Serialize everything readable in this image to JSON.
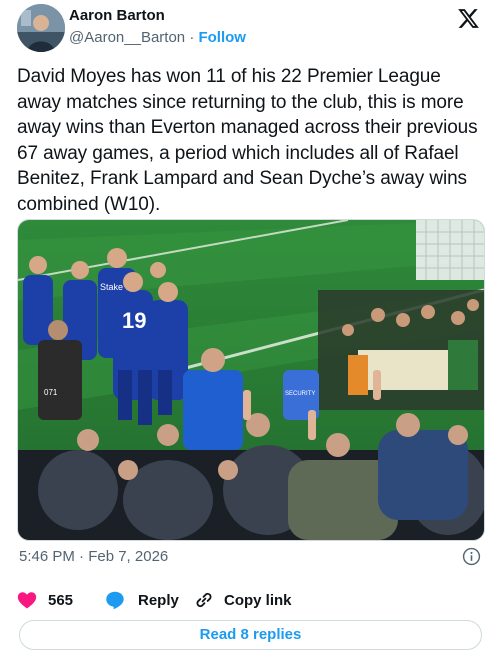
{
  "author": {
    "name": "Aaron Barton",
    "handle": "@Aaron__Barton",
    "separator": "·",
    "follow_label": "Follow"
  },
  "tweet": {
    "text": "David Moyes has won 11 of his 22 Premier League away matches since returning to the club, this is more away wins than Everton managed across their previous 67 away games, a period which includes all of Rafael Benitez, Frank Lampard and Sean Dyche’s away wins combined (W10).",
    "photo": {
      "shirt_number": "19",
      "sponsor": "Stake",
      "camera_bib_number": "071",
      "steward_vest_text": "SECURITY"
    },
    "timestamp": "5:46 PM · Feb 7, 2026"
  },
  "actions": {
    "like_count": "565",
    "reply_label": "Reply",
    "copy_link_label": "Copy link",
    "like_color": "#f91880",
    "accent_color": "#1d9bf0"
  },
  "read_replies_label": "Read 8 replies",
  "icons": [
    "x-logo-icon",
    "info-icon",
    "heart-icon",
    "reply-icon",
    "link-icon"
  ]
}
